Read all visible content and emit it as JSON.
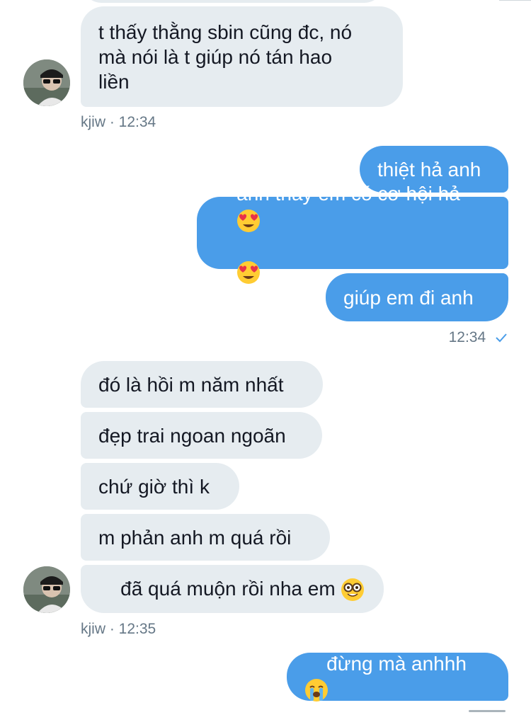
{
  "colors": {
    "incoming_bubble": "#e6ecf0",
    "outgoing_bubble": "#4a9de9",
    "meta_text": "#657786",
    "read_check": "#4a9de9"
  },
  "messages": {
    "m1": "t thấy thằng sbin cũng đc, nó\nmà nói là t giúp nó tán hao\nliền",
    "m1_meta": "kjiw · 12:34",
    "o1": "thiệt hả anh",
    "o2_line1": "anh thấy em có cơ hội hả ",
    "o2_emoji1": "heart-eyes-emoji",
    "o2_emoji2": "heart-eyes-emoji",
    "o3": "giúp em đi anh",
    "o_meta_time": "12:34",
    "o_meta_status_icon": "check-icon",
    "i1": "đó là hồi m năm nhất",
    "i2": "đẹp trai ngoan ngoãn",
    "i3": "chứ giờ thì k",
    "i4": "m phản anh m quá rồi",
    "i5": "đã quá muộn rồi nha em ",
    "i5_emoji": "nerd-face-emoji",
    "i_meta": "kjiw · 12:35",
    "o4": "đừng mà anhhh ",
    "o4_emoji": "crying-face-emoji"
  }
}
